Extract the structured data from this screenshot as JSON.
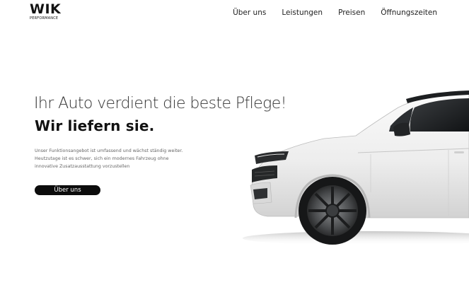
{
  "logo": {
    "main": "WIK",
    "sub": "PERFORMANCE"
  },
  "nav": {
    "items": [
      {
        "label": "Über uns"
      },
      {
        "label": "Leistungen"
      },
      {
        "label": "Preisen"
      },
      {
        "label": "Öffnungszeiten"
      }
    ]
  },
  "hero": {
    "headline": "Ihr Auto verdient die beste Pflege!",
    "subheadline": "Wir liefern sie.",
    "body": "Unser Funktionsangebot ist umfassend und wächst ständig weiter. Heutzutage ist es schwer, sich ein modernes Fahrzeug ohne innovative Zusatzausstattung vorzustellen",
    "cta_label": "Über uns",
    "image": "white-suv-side-view"
  },
  "colors": {
    "background": "#ffffff",
    "text_dark": "#111111",
    "button_bg": "#0c0c0c",
    "button_text": "#ffffff"
  }
}
